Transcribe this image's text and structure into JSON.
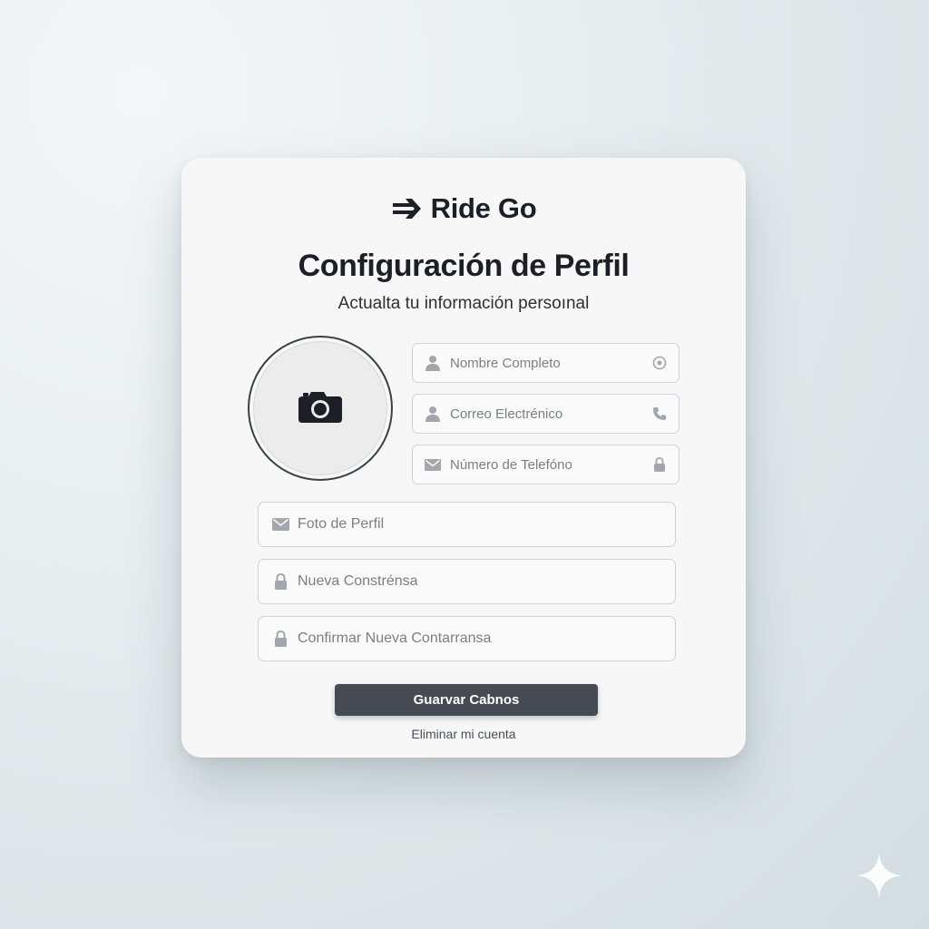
{
  "brand": {
    "name": "Ride Go",
    "icon": "double-arrow-right-icon"
  },
  "header": {
    "title": "Configuración de Perfil",
    "subtitle": "Actualta tu información persoınal"
  },
  "avatar": {
    "icon": "camera-icon"
  },
  "form": {
    "full_name": {
      "placeholder": "Nombre Completo",
      "lead_icon": "user-icon",
      "trail_icon": "info-circle-icon"
    },
    "email": {
      "placeholder": "Correo Electrénico",
      "lead_icon": "user-icon",
      "trail_icon": "phone-icon"
    },
    "phone": {
      "placeholder": "Número de Telefóno",
      "lead_icon": "mail-icon",
      "trail_icon": "lock-icon"
    },
    "profile_photo": {
      "placeholder": "Foto de Perfil",
      "lead_icon": "mail-icon"
    },
    "new_password": {
      "placeholder": "Nueva Constrénsa",
      "lead_icon": "lock-icon"
    },
    "confirm_password": {
      "placeholder": "Confirmar Nueva Contarransa",
      "lead_icon": "lock-icon"
    }
  },
  "actions": {
    "save_label": "Guarvar Cabnos",
    "delete_label": "Eliminar mi cuenta"
  },
  "colors": {
    "button": "#464b53",
    "text": "#1c2026",
    "icon_gray": "#a3a7ac",
    "field_border": "#cfd2d5"
  }
}
